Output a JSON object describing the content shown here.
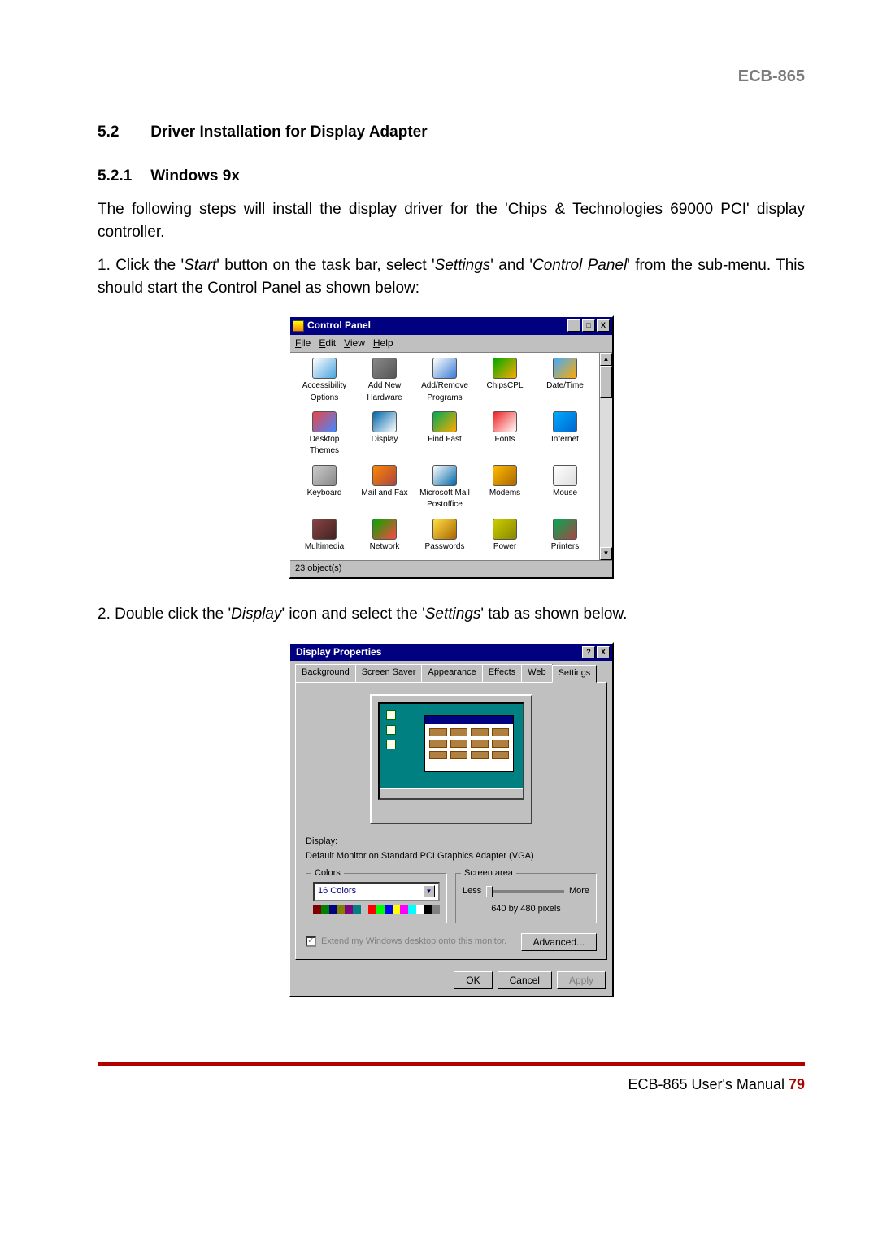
{
  "header": {
    "model": "ECB-865"
  },
  "section": {
    "num": "5.2",
    "title": "Driver Installation for Display Adapter"
  },
  "subsection": {
    "num": "5.2.1",
    "title": "Windows 9x"
  },
  "intro": "The following steps will install the display driver for the 'Chips & Technologies 69000 PCI' display controller.",
  "step1": {
    "pre": "1. Click the '",
    "i1": "Start",
    "mid1": "' button on the task bar, select '",
    "i2": "Settings",
    "mid2": "' and '",
    "i3": "Control Panel",
    "post": "' from the sub-menu. This should start the Control Panel as shown below:"
  },
  "step2": {
    "pre": "2. Double click the '",
    "i1": "Display",
    "mid1": "' icon and select the '",
    "i2": "Settings",
    "post": "' tab as shown below."
  },
  "cp": {
    "title": "Control Panel",
    "menu": {
      "file": "File",
      "edit": "Edit",
      "view": "View",
      "help": "Help"
    },
    "win_min": "_",
    "win_max": "□",
    "win_close": "X",
    "icons": [
      "Accessibility Options",
      "Add New Hardware",
      "Add/Remove Programs",
      "ChipsCPL",
      "Date/Time",
      "Desktop Themes",
      "Display",
      "Find Fast",
      "Fonts",
      "Internet",
      "Keyboard",
      "Mail and Fax",
      "Microsoft Mail Postoffice",
      "Modems",
      "Mouse",
      "Multimedia",
      "Network",
      "Passwords",
      "Power",
      "Printers"
    ],
    "icon_colors": [
      "#fff,#4aa3df",
      "#888,#555",
      "#fff,#3a7bd5",
      "#0a0,#fa0",
      "#4af,#fa0",
      "#e44,#48f",
      "#06a,#fff",
      "#0a5,#fa0",
      "#e22,#fff",
      "#0af,#06c",
      "#ccc,#888",
      "#f80,#a44",
      "#fff,#06a",
      "#fb0,#a60",
      "#fff,#ddd",
      "#844,#422",
      "#0a0,#f44",
      "#fd4,#a60",
      "#cc0,#880",
      "#0a5,#a44"
    ],
    "scroll_up": "▲",
    "scroll_down": "▼",
    "status": "23 object(s)"
  },
  "dp": {
    "title": "Display Properties",
    "help": "?",
    "close": "X",
    "tabs": [
      "Background",
      "Screen Saver",
      "Appearance",
      "Effects",
      "Web",
      "Settings"
    ],
    "display_label": "Display:",
    "display_value": "Default Monitor on Standard PCI Graphics Adapter (VGA)",
    "colors_legend": "Colors",
    "colors_value": "16 Colors",
    "screen_legend": "Screen area",
    "less": "Less",
    "more": "More",
    "res": "640 by 480 pixels",
    "extend": "Extend my Windows desktop onto this monitor.",
    "advanced": "Advanced...",
    "ok": "OK",
    "cancel": "Cancel",
    "apply": "Apply",
    "colorbar": [
      "#800000",
      "#008000",
      "#000080",
      "#808000",
      "#800080",
      "#008080",
      "#c0c0c0",
      "#ff0000",
      "#00ff00",
      "#0000ff",
      "#ffff00",
      "#ff00ff",
      "#00ffff",
      "#ffffff",
      "#000000",
      "#808080"
    ]
  },
  "footer": {
    "text": "ECB-865 User's Manual ",
    "page": "79"
  }
}
